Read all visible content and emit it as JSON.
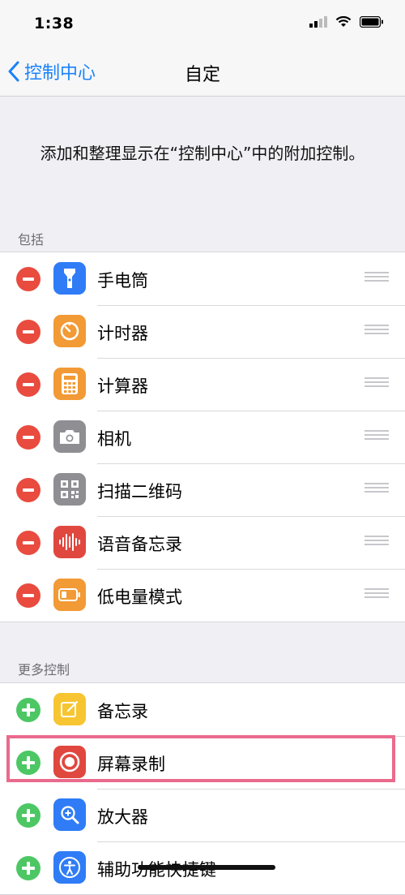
{
  "status_bar": {
    "time": "1:38"
  },
  "nav": {
    "back_label": "控制中心",
    "title": "自定"
  },
  "description": "添加和整理显示在“控制中心”中的附加控制。",
  "included": {
    "header": "包括",
    "items": [
      {
        "label": "手电筒",
        "icon": "flashlight-icon",
        "color": "#2f7cf6"
      },
      {
        "label": "计时器",
        "icon": "timer-icon",
        "color": "#f29a35"
      },
      {
        "label": "计算器",
        "icon": "calculator-icon",
        "color": "#f29a35"
      },
      {
        "label": "相机",
        "icon": "camera-icon",
        "color": "#8e8e93"
      },
      {
        "label": "扫描二维码",
        "icon": "qr-code-icon",
        "color": "#8e8e93"
      },
      {
        "label": "语音备忘录",
        "icon": "voice-memo-icon",
        "color": "#e0473f"
      },
      {
        "label": "低电量模式",
        "icon": "low-power-icon",
        "color": "#f29a35"
      }
    ]
  },
  "more": {
    "header": "更多控制",
    "items": [
      {
        "label": "备忘录",
        "icon": "notes-icon",
        "color": "#f7c531"
      },
      {
        "label": "屏幕录制",
        "icon": "screen-record-icon",
        "color": "#e0473f"
      },
      {
        "label": "放大器",
        "icon": "magnifier-icon",
        "color": "#2f7cf6"
      },
      {
        "label": "辅助功能快捷键",
        "icon": "accessibility-icon",
        "color": "#2f7cf6"
      }
    ]
  },
  "highlight_color": "#ea6a8d"
}
